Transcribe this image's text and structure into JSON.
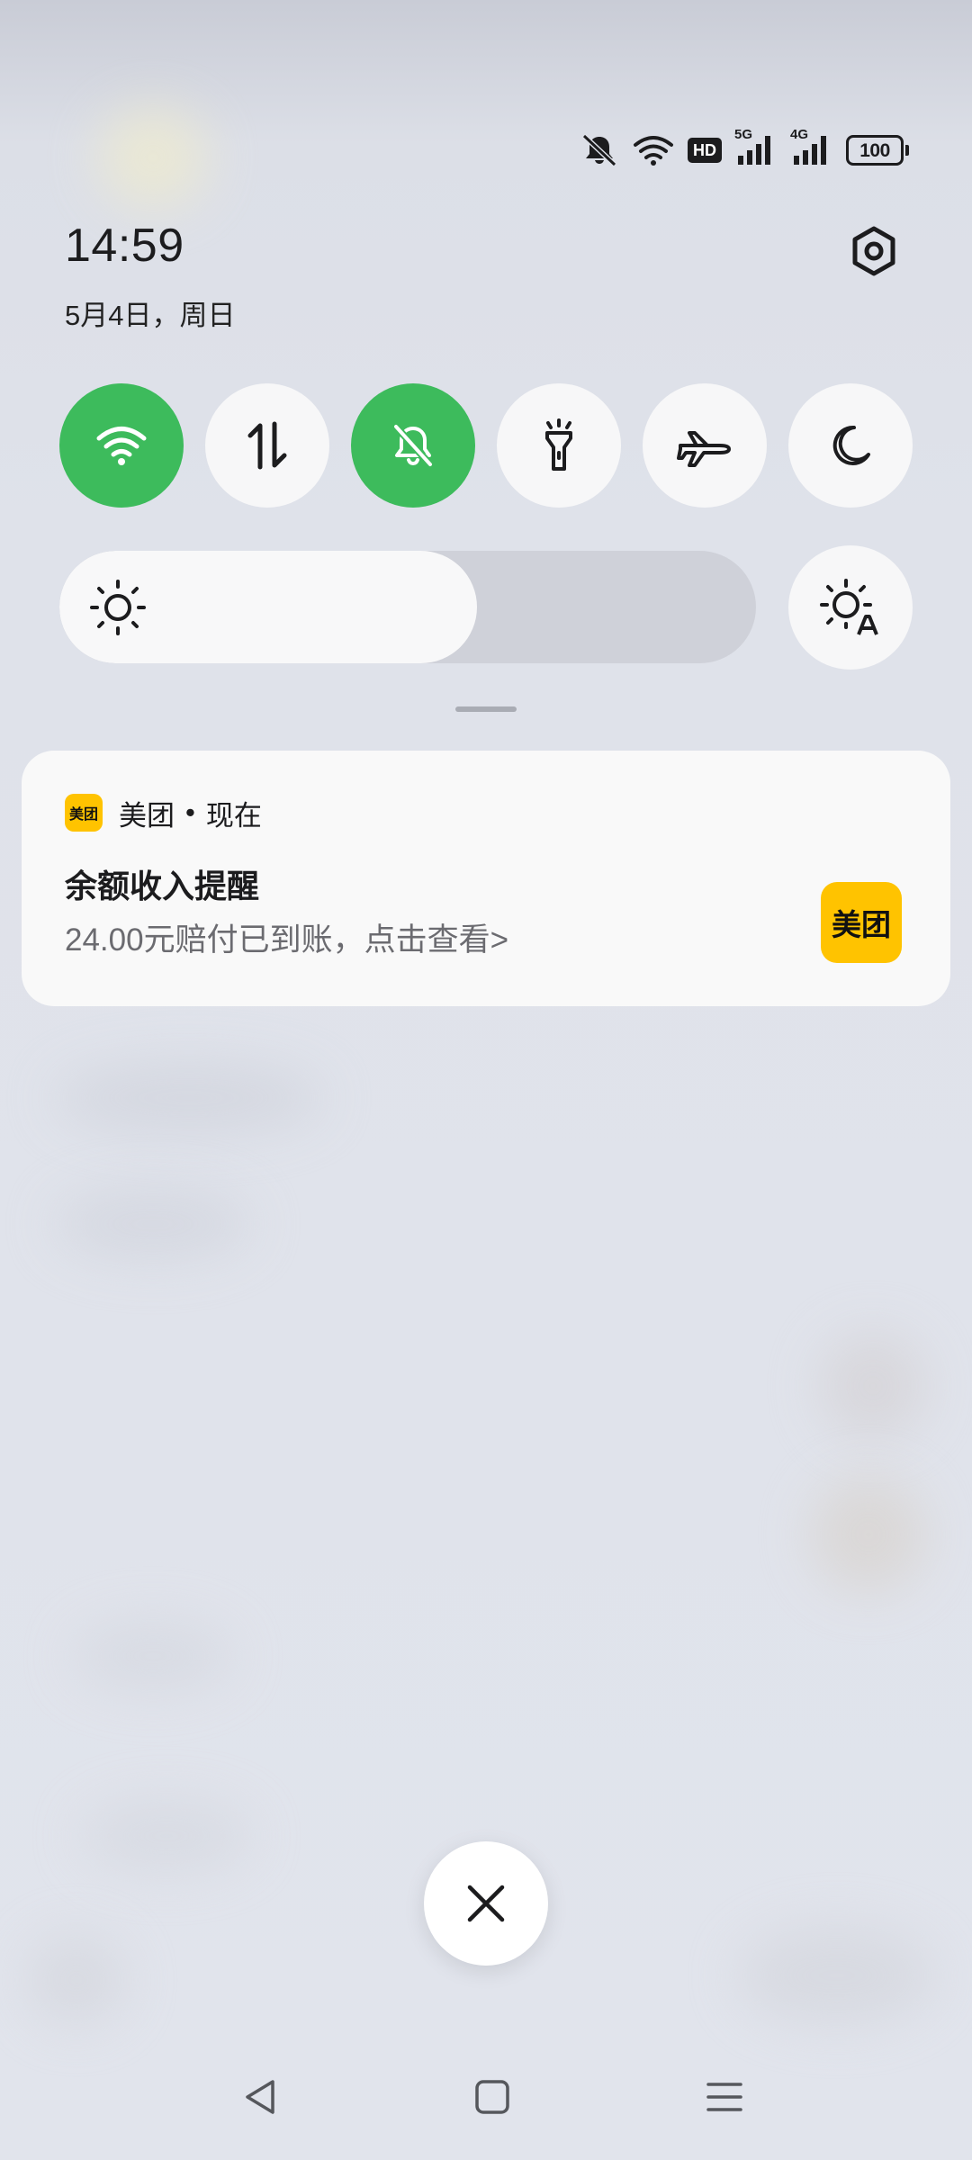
{
  "colors": {
    "accent_green": "#3dbb5c",
    "meituan_yellow": "#ffc300"
  },
  "status_bar": {
    "icons": [
      "mute-icon",
      "wifi-icon",
      "hd-icon",
      "5g-signal-icon",
      "4g-signal-icon",
      "battery-icon"
    ],
    "hd_label": "HD",
    "network_5g": "5G",
    "network_4g": "4G",
    "battery_level": "100"
  },
  "header": {
    "time": "14:59",
    "date": "5月4日，周日"
  },
  "quick_settings": {
    "tiles": [
      {
        "icon": "wifi-icon",
        "active": true
      },
      {
        "icon": "mobile-data-icon",
        "active": false
      },
      {
        "icon": "mute-bell-icon",
        "active": true
      },
      {
        "icon": "flashlight-icon",
        "active": false
      },
      {
        "icon": "airplane-icon",
        "active": false
      },
      {
        "icon": "dark-mode-moon-icon",
        "active": false
      }
    ],
    "brightness_level": 0.6,
    "auto_brightness_icon": "auto-brightness-icon"
  },
  "notification": {
    "app_icon_text": "美团",
    "app_name": "美团",
    "separator": "•",
    "time": "现在",
    "title": "余额收入提醒",
    "body": "24.00元赔付已到账，点击查看>",
    "thumbnail_text": "美团"
  },
  "nav": {
    "icons": [
      "back-icon",
      "home-icon",
      "recents-icon"
    ]
  }
}
